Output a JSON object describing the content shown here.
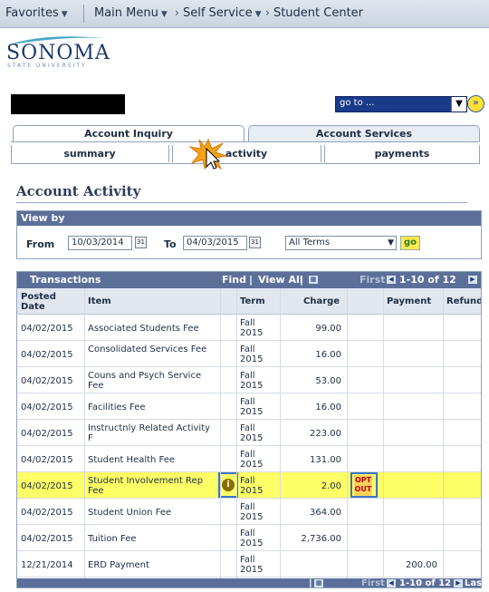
{
  "topnav": {
    "favorites": "Favorites",
    "main_menu": "Main Menu",
    "self_service": "Self Service",
    "student_center": "Student Center"
  },
  "logo": {
    "name": "SONOMA",
    "sub": "STATE UNIVERSITY"
  },
  "goto": {
    "label": "go to ..."
  },
  "tabs": {
    "account_inquiry": "Account Inquiry",
    "account_services": "Account Services"
  },
  "subtabs": {
    "summary": "summary",
    "activity": "activity",
    "payments": "payments"
  },
  "page_title": "Account Activity",
  "viewby": {
    "header": "View by",
    "from_label": "From",
    "from_date": "10/03/2014",
    "to_label": "To",
    "to_date": "04/03/2015",
    "term_select": "All Terms",
    "go": "go"
  },
  "table": {
    "title": "Transactions",
    "find": "Find",
    "view_all": "View All",
    "first": "First",
    "range": "1-10 of 12",
    "last": "Last",
    "columns": [
      "Posted Date",
      "Item",
      "Term",
      "Charge",
      "Payment",
      "Refund"
    ],
    "rows": [
      {
        "date": "04/02/2015",
        "item": "Associated Students Fee",
        "term": "Fall 2015",
        "charge": "99.00",
        "payment": ""
      },
      {
        "date": "04/02/2015",
        "item": "Consolidated Services Fee",
        "term": "Fall 2015",
        "charge": "16.00",
        "payment": ""
      },
      {
        "date": "04/02/2015",
        "item": "Couns and Psych Service Fee",
        "term": "Fall 2015",
        "charge": "53.00",
        "payment": ""
      },
      {
        "date": "04/02/2015",
        "item": "Facilities Fee",
        "term": "Fall 2015",
        "charge": "16.00",
        "payment": ""
      },
      {
        "date": "04/02/2015",
        "item": "Instructnly Related Activity F",
        "term": "Fall 2015",
        "charge": "223.00",
        "payment": ""
      },
      {
        "date": "04/02/2015",
        "item": "Student Health Fee",
        "term": "Fall 2015",
        "charge": "131.00",
        "payment": ""
      },
      {
        "date": "04/02/2015",
        "item": "Student Involvement Rep Fee",
        "term": "Fall 2015",
        "charge": "2.00",
        "payment": "",
        "opt_out": "OPT OUT"
      },
      {
        "date": "04/02/2015",
        "item": "Student Union Fee",
        "term": "Fall 2015",
        "charge": "364.00",
        "payment": ""
      },
      {
        "date": "04/02/2015",
        "item": "Tuition Fee",
        "term": "Fall 2015",
        "charge": "2,736.00",
        "payment": ""
      },
      {
        "date": "12/21/2014",
        "item": "ERD Payment",
        "term": "Fall 2015",
        "charge": "",
        "payment": "200.00"
      }
    ]
  }
}
